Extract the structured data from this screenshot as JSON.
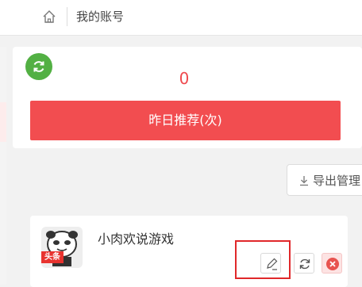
{
  "breadcrumb": {
    "label": "我的账号"
  },
  "stats": {
    "value": "0",
    "label": "昨日推荐(次)"
  },
  "toolbar": {
    "export_label": "导出管理"
  },
  "account": {
    "name": "小肉欢说游戏",
    "avatar_tag": "头条"
  },
  "colors": {
    "accent_red": "#f24d50",
    "value_red": "#ef4a4e",
    "refresh_green": "#52b043",
    "highlight_red": "#e0282a"
  },
  "icons": {
    "home": "home-icon",
    "refresh": "refresh-icon",
    "export": "download-icon",
    "edit": "pencil-icon",
    "sync": "sync-icon",
    "delete": "close-icon"
  }
}
